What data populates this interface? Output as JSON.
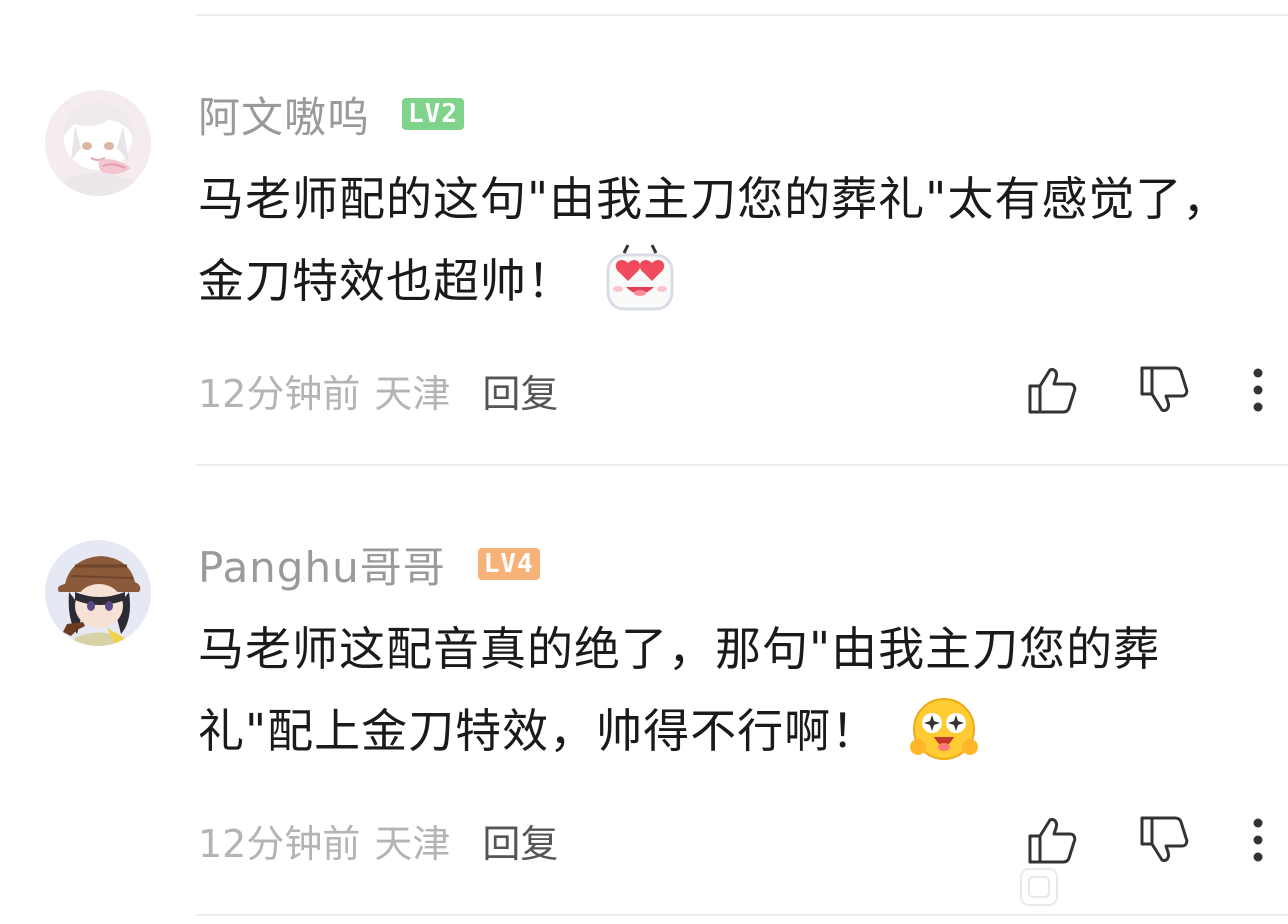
{
  "comments": [
    {
      "username": "阿文嗷呜",
      "level": "LV2",
      "level_color": "#7fd38a",
      "content": "马老师配的这句\"由我主刀您的葬礼\"太有感觉了，金刀特效也超帅！",
      "emoji": "heart-eyes-emoji",
      "time": "12分钟前",
      "location": "天津",
      "reply_label": "回复",
      "avatar": "anime-avatar-white-hair"
    },
    {
      "username": "Panghu哥哥",
      "level": "LV4",
      "level_color": "#f7b27a",
      "content": "马老师这配音真的绝了，那句\"由我主刀您的葬礼\"配上金刀特效，帅得不行啊！",
      "emoji": "starry-eyes-emoji",
      "time": "12分钟前",
      "location": "天津",
      "reply_label": "回复",
      "avatar": "anime-avatar-detective-pipe"
    }
  ],
  "icons": {
    "like": "thumbs-up-icon",
    "dislike": "thumbs-down-icon",
    "more": "more-vertical-icon"
  },
  "colors": {
    "username": "#9a9a9a",
    "content": "#1a1a1a",
    "meta": "#b4b4b4",
    "reply": "#555555"
  }
}
